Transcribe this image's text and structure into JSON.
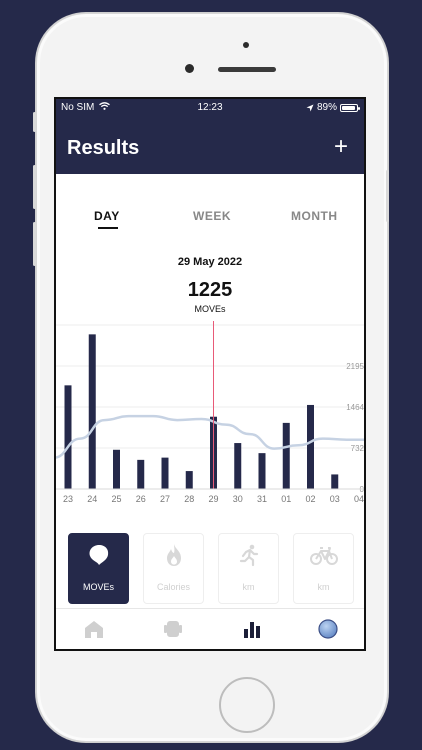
{
  "status_bar": {
    "carrier": "No SIM",
    "time": "12:23",
    "battery": "89%",
    "battery_level": 0.89
  },
  "header": {
    "title": "Results",
    "add_label": "+"
  },
  "tabs": [
    {
      "label": "DAY",
      "active": true
    },
    {
      "label": "WEEK",
      "active": false
    },
    {
      "label": "MONTH",
      "active": false
    }
  ],
  "selected": {
    "date": "29 May 2022",
    "value": "1225",
    "unit": "MOVEs"
  },
  "chart_data": {
    "type": "bar",
    "categories": [
      "23",
      "24",
      "25",
      "26",
      "27",
      "28",
      "29",
      "30",
      "31",
      "01",
      "02",
      "03",
      "04"
    ],
    "values": [
      1850,
      2760,
      700,
      520,
      560,
      320,
      1290,
      820,
      640,
      1180,
      1500,
      260,
      0
    ],
    "trend": [
      560,
      900,
      1230,
      1300,
      1300,
      1230,
      1250,
      1150,
      980,
      720,
      780,
      900,
      880
    ],
    "selected_category": "29",
    "ylim": [
      0,
      2927
    ],
    "yticks": [
      "0",
      "732",
      "1464",
      "2195"
    ],
    "xlabel": "",
    "ylabel": "",
    "colors": {
      "bar": "#25294a",
      "trend": "#c6d2e3",
      "cursor": "#e85a78",
      "grid": "#eeeeee"
    }
  },
  "metrics": [
    {
      "label": "MOVEs",
      "icon": "moves-icon",
      "active": true
    },
    {
      "label": "Calories",
      "icon": "flame-icon",
      "active": false
    },
    {
      "label": "km",
      "icon": "runner-icon",
      "active": false
    },
    {
      "label": "km",
      "icon": "bicycle-icon",
      "active": false
    }
  ],
  "bottom_nav": [
    {
      "icon": "home-icon"
    },
    {
      "icon": "device-icon"
    },
    {
      "icon": "bar-chart-icon",
      "active": true
    },
    {
      "icon": "profile-icon"
    }
  ],
  "colors": {
    "brand": "#25294a",
    "accent": "#e85a78"
  }
}
